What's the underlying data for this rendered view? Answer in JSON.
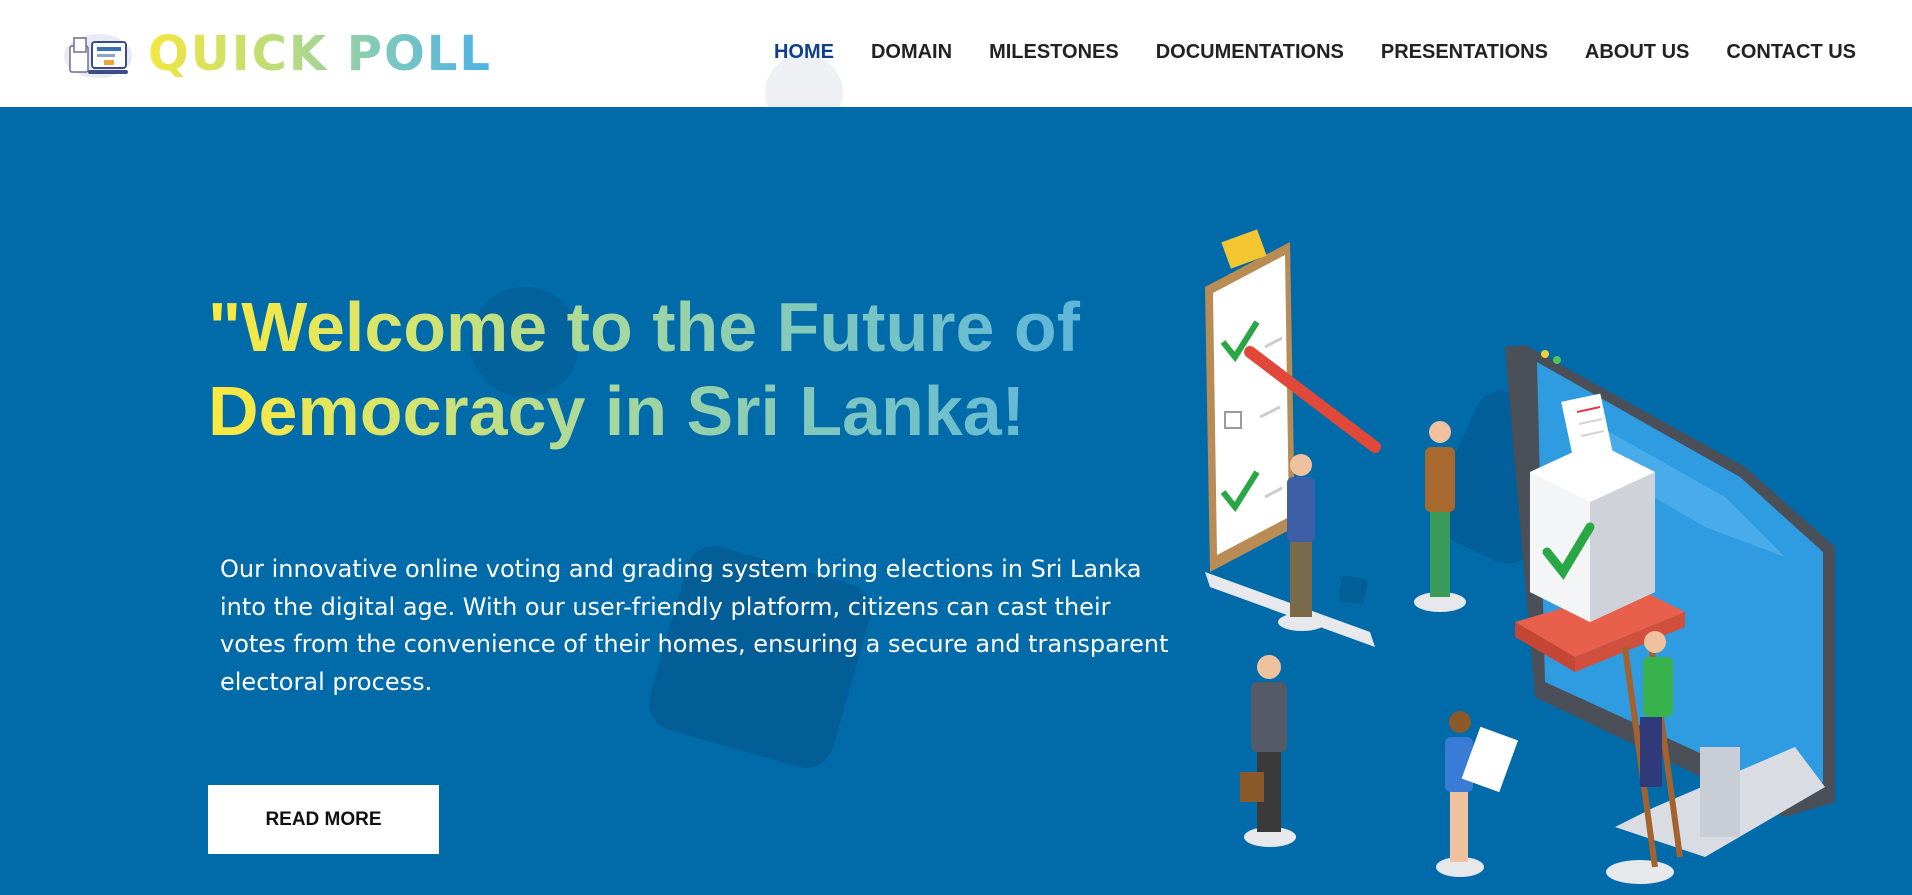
{
  "header": {
    "logo_text": "QUICK POLL",
    "nav": [
      {
        "label": "HOME",
        "active": true
      },
      {
        "label": "DOMAIN",
        "active": false
      },
      {
        "label": "MILESTONES",
        "active": false
      },
      {
        "label": "DOCUMENTATIONS",
        "active": false
      },
      {
        "label": "PRESENTATIONS",
        "active": false
      },
      {
        "label": "ABOUT US",
        "active": false
      },
      {
        "label": "CONTACT US",
        "active": false
      }
    ]
  },
  "hero": {
    "title_line1": "\"Welcome to the Future of",
    "title_line2": "Democracy in Sri Lanka!",
    "description": "Our innovative online voting and grading system bring elections in Sri Lanka into the digital age. With our user-friendly platform, citizens can cast their votes from the convenience of their homes, ensuring a secure and transparent electoral process.",
    "button_label": "READ MORE"
  },
  "colors": {
    "hero_background": "#006ba8",
    "nav_active": "#0f3f8c",
    "nav_text": "#222222"
  }
}
